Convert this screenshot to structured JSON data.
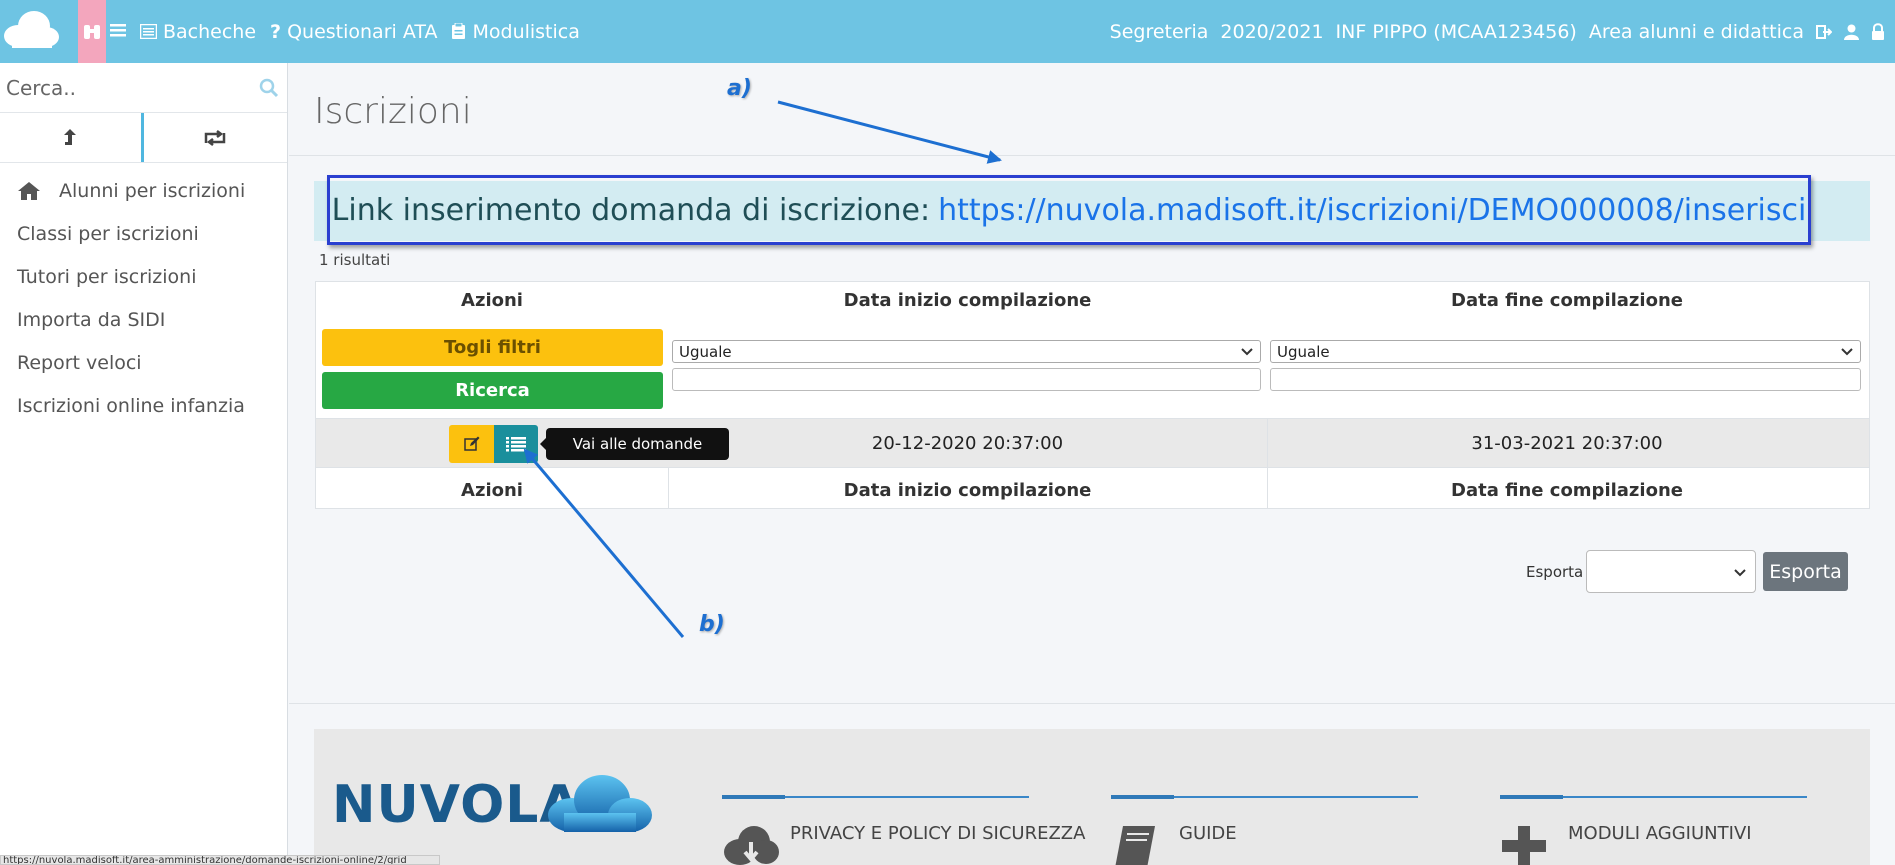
{
  "topbar": {
    "nav": [
      {
        "label": "Bacheche",
        "icon": "bulletin-icon"
      },
      {
        "label": "Questionari ATA",
        "icon": "question-icon"
      },
      {
        "label": "Modulistica",
        "icon": "clipboard-icon"
      }
    ],
    "right": {
      "office": "Segreteria",
      "year": "2020/2021",
      "school": "INF PIPPO (MCAA123456)",
      "area": "Area alunni e didattica"
    }
  },
  "sidebar": {
    "search_placeholder": "Cerca..",
    "items": [
      {
        "label": "Alunni per iscrizioni"
      },
      {
        "label": "Classi per iscrizioni"
      },
      {
        "label": "Tutori per iscrizioni"
      },
      {
        "label": "Importa da SIDI"
      },
      {
        "label": "Report veloci"
      },
      {
        "label": "Iscrizioni online infanzia"
      }
    ]
  },
  "main": {
    "title": "Iscrizioni",
    "link_label": "Link inserimento domanda di iscrizione:",
    "link_url": "https://nuvola.madisoft.it/iscrizioni/DEMO000008/inserisci",
    "results": "1 risultati",
    "grid": {
      "headers": [
        "Azioni",
        "Data inizio compilazione",
        "Data fine compilazione"
      ],
      "clear_filters": "Togli filtri",
      "search": "Ricerca",
      "filter_operator": "Uguale",
      "row": {
        "start": "20-12-2020 20:37:00",
        "end": "31-03-2021 20:37:00"
      },
      "tooltip": "Vai alle domande"
    },
    "export": {
      "label": "Esporta",
      "button": "Esporta"
    }
  },
  "footer": {
    "brand": "NUVOLA",
    "columns": [
      {
        "label": "PRIVACY E POLICY DI SICUREZZA",
        "icon": "cloud-download-icon"
      },
      {
        "label": "GUIDE",
        "icon": "book-icon"
      },
      {
        "label": "MODULI AGGIUNTIVI",
        "icon": "plus-icon"
      }
    ]
  },
  "statusbar": "https://nuvola.madisoft.it/area-amministrazione/domande-iscrizioni-online/2/grid",
  "annotations": {
    "a": "a)",
    "b": "b)"
  },
  "colors": {
    "topbar": "#6ec4e3",
    "warning": "#fcc10e",
    "success": "#27a844",
    "info": "#1a8f9c",
    "annotation": "#1d6fd1",
    "link_border": "#2a3fd0"
  }
}
